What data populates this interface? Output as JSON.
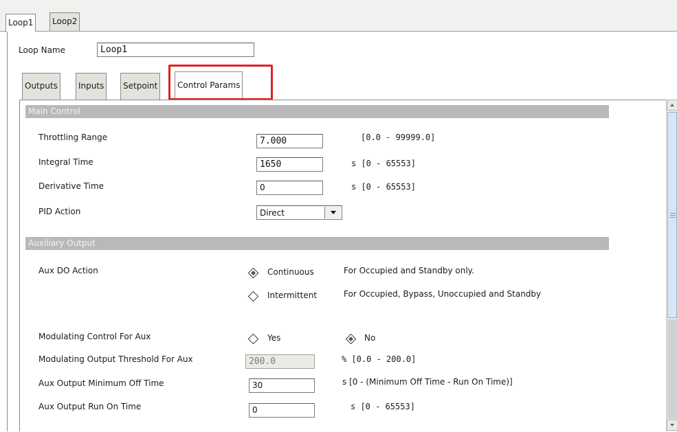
{
  "loop_tabs": [
    {
      "label": "Loop1",
      "active": true
    },
    {
      "label": "Loop2",
      "active": false
    }
  ],
  "loop_name": {
    "label": "Loop Name",
    "value": "Loop1"
  },
  "sub_tabs": [
    {
      "label": "Outputs",
      "active": false
    },
    {
      "label": "Inputs",
      "active": false
    },
    {
      "label": "Setpoint",
      "active": false
    },
    {
      "label": "Control Params",
      "active": true
    }
  ],
  "main_control": {
    "header": "Main Control",
    "throttling_range": {
      "label": "Throttling Range",
      "value": "7.000",
      "range": "[0.0 - 99999.0]"
    },
    "integral_time": {
      "label": "Integral Time",
      "value": "1650",
      "range": "s [0 - 65553]"
    },
    "derivative_time": {
      "label": "Derivative Time",
      "value": "0",
      "range": "s [0 - 65553]"
    },
    "pid_action": {
      "label": "PID Action",
      "value": "Direct"
    }
  },
  "aux_output": {
    "header": "Auxiliary Output",
    "aux_do_action": {
      "label": "Aux DO Action",
      "options": [
        {
          "label": "Continuous",
          "note": "For Occupied and Standby only.",
          "checked": true
        },
        {
          "label": "Intermittent",
          "note": "For Occupied, Bypass, Unoccupied and Standby",
          "checked": false
        }
      ]
    },
    "modulating_control": {
      "label": "Modulating Control For Aux",
      "options": [
        {
          "label": "Yes",
          "checked": false
        },
        {
          "label": "No",
          "checked": true
        }
      ]
    },
    "modulating_threshold": {
      "label": "Modulating Output Threshold For Aux",
      "value": "200.0",
      "range": "% [0.0 - 200.0]",
      "disabled": true
    },
    "min_off_time": {
      "label": "Aux Output Minimum Off Time",
      "value": "30",
      "range": "s [0 - (Minimum Off Time - Run On Time)]"
    },
    "run_on_time": {
      "label": "Aux Output Run On Time",
      "value": "0",
      "range": "s [0 - 65553]"
    }
  },
  "colors": {
    "highlight": "#e02020",
    "section_header": "#b9b9b9",
    "scroll_thumb": "#d7e6f5"
  }
}
